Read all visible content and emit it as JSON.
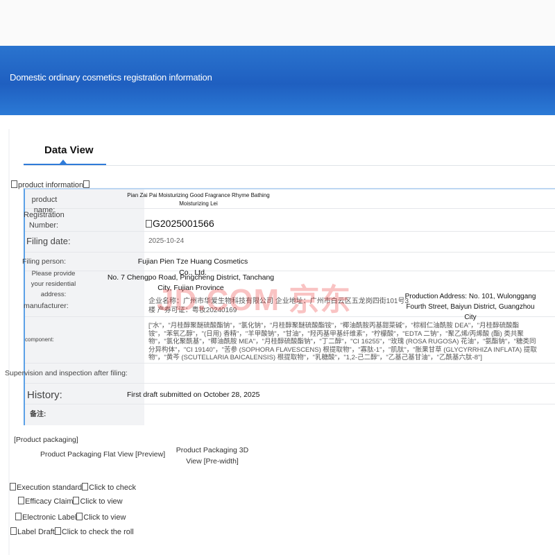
{
  "banner": {
    "title": "Domestic ordinary cosmetics registration information"
  },
  "tabs": [
    {
      "label": "Data View"
    }
  ],
  "product_section": {
    "label": "product information"
  },
  "fields": {
    "product_name": {
      "label": "product name:",
      "value": "Pian Zai Pai Moisturizing Good Fragrance Rhyme Bathing Moisturizing Lei"
    },
    "registration": {
      "label": "Registration Number:",
      "value": "G2025001566"
    },
    "filing_date": {
      "label": "Filing date:",
      "value": "2025-10-24"
    },
    "filing_person": {
      "label": "Filing person:",
      "value": "Fujian Pien Tze Huang Cosmetics Co., Ltd."
    },
    "address": {
      "label": "Please provide your residential address:",
      "value": "No. 7 Chengpo Road, Pingcheng District, Tanchang City, Fujian Province"
    },
    "manufacturer": {
      "label": "manufacturer:",
      "company_text": "企业名称：广州市华爱生物科技有限公司 企业地址：广州市白云区五龙岗四街101号3楼 产券可证：粤妆20240169",
      "production_address": "Production Address: No. 101, Wulonggang Fourth Street, Baiyun District, Guangzhou City"
    },
    "component": {
      "label": "component:",
      "value": "[\"水\"，\"月桂醇聚醚硫酸酯钠\"，\"氯化钠\"，\"月桂醇聚醚硫酸酯铵\"，\"椰油酰胺丙基甜菜碱\"，\"棕榈仁油酰胺 DEA\"，\"月桂醇硫酸酯铵\"，\"苯氧乙醇\"，\"(日用) 香精\"，\"羊甲酸钠\"，\"甘油\"，\"羟丙基甲基纤维素\"，\"柠檬酸\"，\"EDTA 二钠\"，\"聚乙烯/丙烯酸 (酯) 类共聚物\"，\"氯化聚酰基\"，\"椰油酰胺 MEA\"，\"月桂醇硫酸酯钠\"，\"丁二醇\"，\"CI 16255\"，\"玫瑰 (ROSA RUGOSA) 花油\"，\"氨酯钠\"，\"糖类同分异构体\"，\"CI 19140\"，\"苦参 (SOPHORA FLAVESCENS) 根提取物\"，\"寡肽-1\"，\"肌肽\"，\"胀果甘草 (GLYCYRRHIZA INFLATA) 提取物\"，\"黄芩 (SCUTELLARIA BAICALENSIS) 根提取物\"，\"乳糖酸\"，\"1,2-己二醇\"，\"乙基己基甘油\"，\"乙酰基六肽-8\"]"
    },
    "supervision": {
      "label": "Supervision and inspection after filing:"
    },
    "history": {
      "label": "History:",
      "value": "First draft submitted on October 28, 2025"
    },
    "remarks": {
      "label": "备注:"
    }
  },
  "watermark": "JD.COM 京东",
  "packaging": {
    "section_label": "[Product packaging]",
    "flat_view": "Product Packaging Flat View [Preview]",
    "view_3d": "Product Packaging 3D View [Pre-width]"
  },
  "bottom_links": [
    {
      "label": "Execution standard",
      "action": "Click to check"
    },
    {
      "label": "Efficacy Claim",
      "action": "Click to view"
    },
    {
      "label": "Electronic Label",
      "action": "Click to view"
    },
    {
      "label": "Label Draft",
      "action": "Click to check the roll"
    }
  ]
}
